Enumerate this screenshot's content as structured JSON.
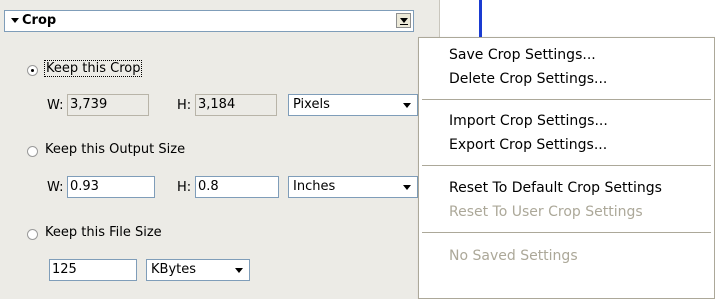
{
  "panel": {
    "title": "Crop",
    "options": [
      {
        "label": "Keep this Crop",
        "selected": true,
        "w_label": "W:",
        "w_value": "3,739",
        "h_label": "H:",
        "h_value": "3,184",
        "unit": "Pixels"
      },
      {
        "label": "Keep this Output Size",
        "selected": false,
        "w_label": "W:",
        "w_value": "0.93",
        "h_label": "H:",
        "h_value": "0.8",
        "unit": "Inches"
      },
      {
        "label": "Keep this File Size",
        "selected": false,
        "size_value": "125",
        "unit": "KBytes"
      }
    ]
  },
  "menu": {
    "items": [
      {
        "label": "Save Crop Settings...",
        "enabled": true
      },
      {
        "label": "Delete Crop Settings...",
        "enabled": true
      },
      {
        "label": "Import Crop Settings...",
        "enabled": true
      },
      {
        "label": "Export Crop Settings...",
        "enabled": true
      },
      {
        "label": "Reset To Default Crop Settings",
        "enabled": true
      },
      {
        "label": "Reset To User Crop Settings",
        "enabled": false
      },
      {
        "label": "No Saved Settings",
        "enabled": false
      }
    ]
  },
  "colors": {
    "panel_bg": "#ecebe6",
    "accent_line": "#1a3bd1",
    "disabled_text": "#aca899"
  }
}
